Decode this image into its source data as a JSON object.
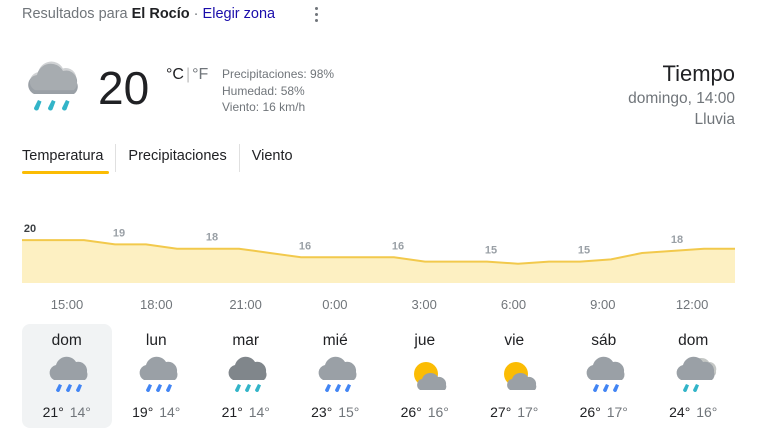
{
  "header": {
    "results_prefix": "Resultados para",
    "location": "El Rocío",
    "separator": "·",
    "change_zone": "Elegir zona"
  },
  "current": {
    "temperature": "20",
    "unit_c": "°C",
    "unit_sep": "|",
    "unit_f": "°F",
    "precipitation": "Precipitaciones: 98%",
    "humidity": "Humedad: 58%",
    "wind": "Viento: 16 km/h",
    "icon": "rain-cloud-icon"
  },
  "summary": {
    "title": "Tiempo",
    "datetime": "domingo, 14:00",
    "condition": "Lluvia"
  },
  "tabs": [
    {
      "label": "Temperatura",
      "active": true
    },
    {
      "label": "Precipitaciones",
      "active": false
    },
    {
      "label": "Viento",
      "active": false
    }
  ],
  "chart_data": {
    "type": "area",
    "x": [
      "14:00",
      "15:00",
      "16:00",
      "17:00",
      "18:00",
      "19:00",
      "20:00",
      "21:00",
      "22:00",
      "23:00",
      "0:00",
      "1:00",
      "2:00",
      "3:00",
      "4:00",
      "5:00",
      "6:00",
      "7:00",
      "8:00",
      "9:00",
      "10:00",
      "11:00",
      "12:00",
      "13:00"
    ],
    "values": [
      20,
      20,
      20,
      19,
      19,
      18,
      18,
      18,
      17,
      16,
      16,
      16,
      16,
      15,
      15,
      15,
      14.5,
      15,
      15,
      15.5,
      17,
      17.5,
      18,
      18
    ],
    "point_labels": [
      {
        "index": 0,
        "text": "20"
      },
      {
        "index": 3,
        "text": "19"
      },
      {
        "index": 6,
        "text": "18"
      },
      {
        "index": 9,
        "text": "16"
      },
      {
        "index": 12,
        "text": "16"
      },
      {
        "index": 15,
        "text": "15"
      },
      {
        "index": 18,
        "text": "15"
      },
      {
        "index": 21,
        "text": "18"
      }
    ],
    "tick_labels": [
      "15:00",
      "18:00",
      "21:00",
      "0:00",
      "3:00",
      "6:00",
      "9:00",
      "12:00"
    ],
    "line_color": "#f2c94c",
    "fill_color": "#fdf0c2",
    "label_color": "#9aa0a6",
    "ylim": [
      10,
      24
    ]
  },
  "forecast": [
    {
      "day": "dom",
      "high": "21°",
      "low": "14°",
      "icon": "rain",
      "selected": true
    },
    {
      "day": "lun",
      "high": "19°",
      "low": "14°",
      "icon": "rain",
      "selected": false
    },
    {
      "day": "mar",
      "high": "21°",
      "low": "14°",
      "icon": "heavy-rain",
      "selected": false
    },
    {
      "day": "mié",
      "high": "23°",
      "low": "15°",
      "icon": "rain",
      "selected": false
    },
    {
      "day": "jue",
      "high": "26°",
      "low": "16°",
      "icon": "partly-cloudy",
      "selected": false
    },
    {
      "day": "vie",
      "high": "27°",
      "low": "17°",
      "icon": "partly-cloudy",
      "selected": false
    },
    {
      "day": "sáb",
      "high": "26°",
      "low": "17°",
      "icon": "rain",
      "selected": false
    },
    {
      "day": "dom",
      "high": "24°",
      "low": "16°",
      "icon": "cloudy-rain",
      "selected": false
    }
  ],
  "colors": {
    "rain_drop": "#4285f4",
    "rain_drop_heavy": "#32b4c8",
    "cloud": "#9aa0a6",
    "cloud_dark": "#80868b",
    "sun": "#fbbc04",
    "accent": "#fbbc04",
    "link": "#1a0dab"
  }
}
